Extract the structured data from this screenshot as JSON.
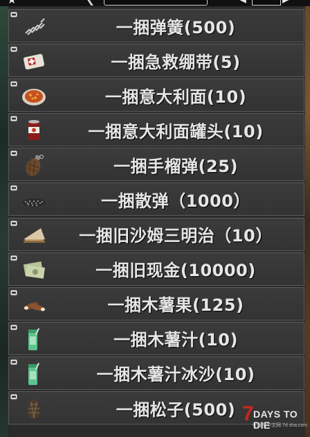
{
  "items": [
    {
      "label": "一捆弹簧(500)",
      "icon": "spring-icon"
    },
    {
      "label": "一捆急救绷带(5)",
      "icon": "bandage-icon"
    },
    {
      "label": "一捆意大利面(10)",
      "icon": "pasta-icon"
    },
    {
      "label": "一捆意大利面罐头(10)",
      "icon": "canned-pasta-icon"
    },
    {
      "label": "一捆手榴弹(25)",
      "icon": "grenade-icon"
    },
    {
      "label": "一捆散弹（1000）",
      "icon": "shotgun-shells-icon"
    },
    {
      "label": "一捆旧沙姆三明治（10）",
      "icon": "sandwich-icon"
    },
    {
      "label": "一捆旧现金(10000)",
      "icon": "cash-icon"
    },
    {
      "label": "一捆木薯果(125)",
      "icon": "cassava-icon"
    },
    {
      "label": "一捆木薯汁(10)",
      "icon": "cassava-juice-icon"
    },
    {
      "label": "一捆木薯汁冰沙(10)",
      "icon": "cassava-smoothie-icon"
    },
    {
      "label": "一捆松子(500)",
      "icon": "pine-nut-icon"
    }
  ],
  "watermark": {
    "seven": "7",
    "brand": "DAYS TO DIE",
    "sub": "七日杀中文网 7d sha.com"
  },
  "colors": {
    "row_bg": "#383838",
    "row_border": "#5b5b5b",
    "text": "#e6e6e6",
    "brand_red": "#c8261f"
  }
}
